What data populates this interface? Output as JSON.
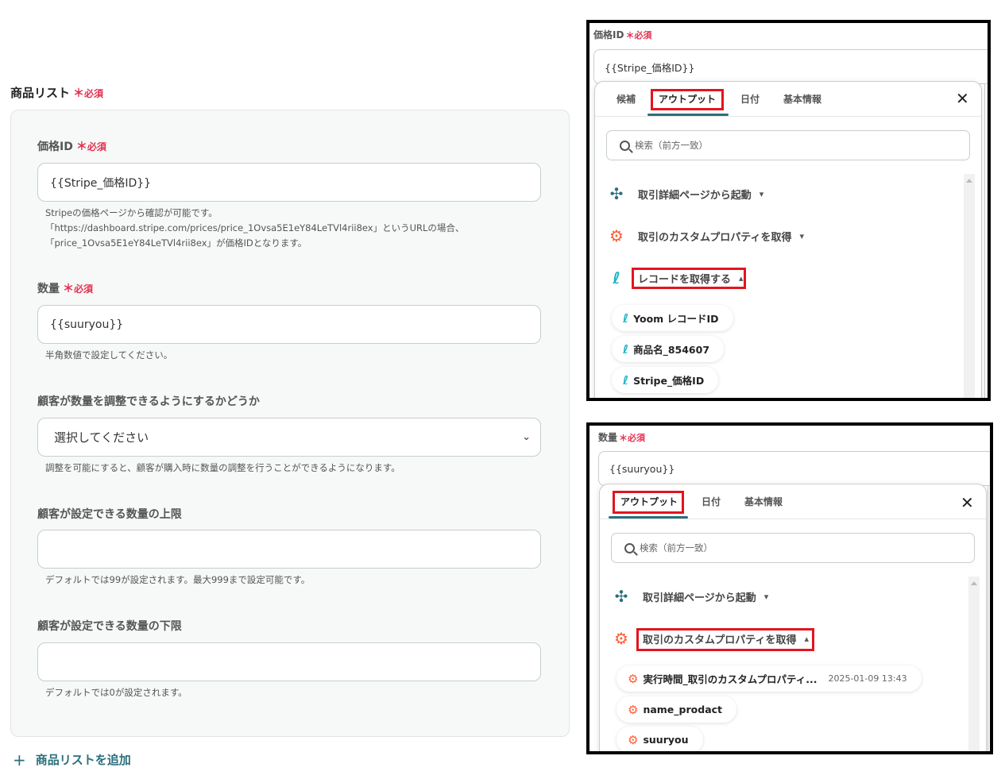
{
  "form": {
    "section_title": "商品リスト",
    "required_mark": "＊",
    "required_text": "必須",
    "price_id": {
      "label": "価格ID",
      "value": "{{Stripe_価格ID}}",
      "help_1": "Stripeの価格ページから確認が可能です。",
      "help_2": "「https://dashboard.stripe.com/prices/price_1Ovsa5E1eY84LeTVl4rii8ex」というURLの場合、",
      "help_3": "「price_1Ovsa5E1eY84LeTVl4rii8ex」が価格IDとなります。"
    },
    "quantity": {
      "label": "数量",
      "value": "{{suuryou}}",
      "help": "半角数値で設定してください。"
    },
    "adjustable": {
      "label": "顧客が数量を調整できるようにするかどうか",
      "selected": "選択してください",
      "help": "調整を可能にすると、顧客が購入時に数量の調整を行うことができるようになります。"
    },
    "max_qty": {
      "label": "顧客が設定できる数量の上限",
      "value": "",
      "help": "デフォルトでは99が設定されます。最大999まで設定可能です。"
    },
    "min_qty": {
      "label": "顧客が設定できる数量の下限",
      "value": "",
      "help": "デフォルトでは0が設定されます。"
    },
    "add_label": "商品リストを追加"
  },
  "panel1": {
    "label": "価格ID",
    "input_value": "{{Stripe_価格ID}}",
    "tabs": [
      "候補",
      "アウトプット",
      "日付",
      "基本情報"
    ],
    "active_tab": "アウトプット",
    "search_placeholder": "検索（前方一致）",
    "groups": [
      {
        "label": "取引詳細ページから起動",
        "icon": "puzzle-icon",
        "expanded": false
      },
      {
        "label": "取引のカスタムプロパティを取得",
        "icon": "hubspot-icon",
        "expanded": false
      },
      {
        "label": "レコードを取得する",
        "icon": "yoom-icon",
        "expanded": true
      }
    ],
    "items": [
      "Yoom レコードID",
      "商品名_854607",
      "Stripe_価格ID"
    ]
  },
  "panel2": {
    "label": "数量",
    "input_value": "{{suuryou}}",
    "tabs": [
      "アウトプット",
      "日付",
      "基本情報"
    ],
    "active_tab": "アウトプット",
    "search_placeholder": "検索（前方一致）",
    "groups": [
      {
        "label": "取引詳細ページから起動",
        "icon": "puzzle-icon",
        "expanded": false
      },
      {
        "label": "取引のカスタムプロパティを取得",
        "icon": "hubspot-icon",
        "expanded": true
      }
    ],
    "items": [
      {
        "label": "実行時間_取引のカスタムプロパティ...",
        "value": "2025-01-09 13:43"
      },
      {
        "label": "name_prodact",
        "value": ""
      },
      {
        "label": "suuryou",
        "value": ""
      }
    ]
  },
  "colors": {
    "required": "#e5304f",
    "accent": "#2a6f7b",
    "highlight": "#e3141f",
    "hubspot": "#ff5c35",
    "yoom": "#19b2c6"
  }
}
